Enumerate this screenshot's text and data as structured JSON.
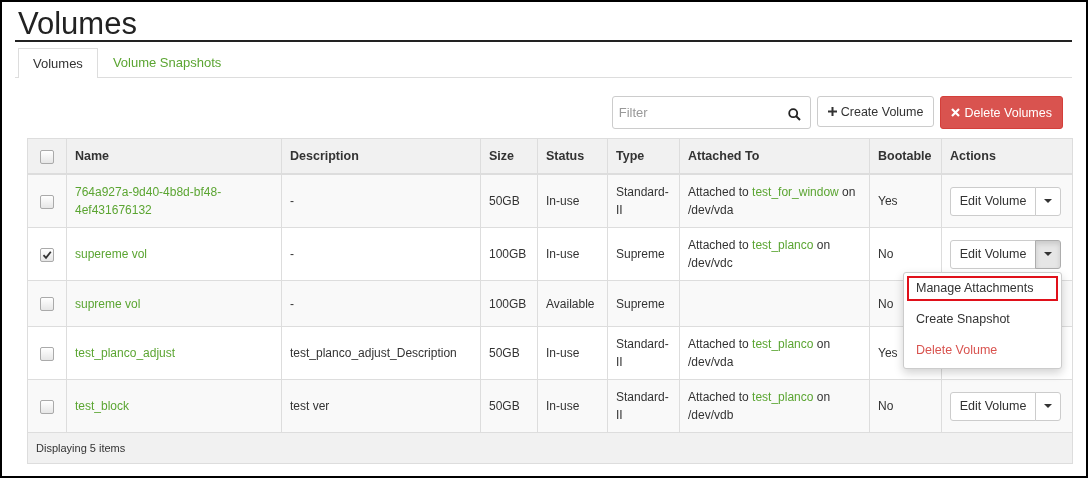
{
  "page": {
    "title": "Volumes"
  },
  "tabs": [
    {
      "label": "Volumes",
      "selected": true
    },
    {
      "label": "Volume Snapshots",
      "selected": false
    }
  ],
  "toolbar": {
    "filter": {
      "placeholder": "Filter"
    },
    "buttons": [
      {
        "label": "Create Volume",
        "kind": "create"
      },
      {
        "label": "Delete Volumes",
        "kind": "delete"
      }
    ]
  },
  "table": {
    "select_all": {
      "checked": false
    },
    "columns": [
      "Name",
      "Description",
      "Size",
      "Status",
      "Type",
      "Attached To",
      "Bootable",
      "Actions"
    ],
    "rows": [
      {
        "checked": false,
        "name": "764a927a-9d40-4b8d-bf48-4ef431676132",
        "description": "-",
        "size": "50GB",
        "status": "In-use",
        "type": "Standard-II",
        "attached_to": {
          "prefix": "Attached to",
          "instance": "test_for_window",
          "suffix": "on /dev/vda"
        },
        "bootable": "Yes",
        "action": {
          "label": "Edit Volume",
          "menu_open": false
        }
      },
      {
        "checked": true,
        "name": "supereme vol",
        "description": "-",
        "size": "100GB",
        "status": "In-use",
        "type": "Supreme",
        "attached_to": {
          "prefix": "Attached to",
          "instance": "test_planco",
          "suffix": "on /dev/vdc"
        },
        "bootable": "No",
        "action": {
          "label": "Edit Volume",
          "menu_open": true,
          "menu": [
            {
              "label": "Manage Attachments",
              "kind": "normal",
              "highlighted": true
            },
            {
              "label": "Create Snapshot",
              "kind": "normal",
              "highlighted": false
            },
            {
              "label": "Delete Volume",
              "kind": "danger",
              "highlighted": false
            }
          ]
        }
      },
      {
        "checked": false,
        "name": "supreme vol",
        "description": "-",
        "size": "100GB",
        "status": "Available",
        "type": "Supreme",
        "bootable": "No",
        "action": {}
      },
      {
        "checked": false,
        "name": "test_planco_adjust",
        "description": "test_planco_adjust_Description",
        "size": "50GB",
        "status": "In-use",
        "type": "Standard-II",
        "attached_to": {
          "prefix": "Attached to",
          "instance": "test_planco",
          "suffix": "on /dev/vda"
        },
        "bootable": "Yes",
        "action": {}
      },
      {
        "checked": false,
        "name": "test_block",
        "description": "test ver",
        "size": "50GB",
        "status": "In-use",
        "type": "Standard-II",
        "attached_to": {
          "prefix": "Attached to",
          "instance": "test_planco",
          "suffix": "on /dev/vdb"
        },
        "bootable": "No",
        "action": {
          "label": "Edit Volume",
          "menu_open": false
        }
      }
    ],
    "footer": "Displaying 5 items"
  }
}
